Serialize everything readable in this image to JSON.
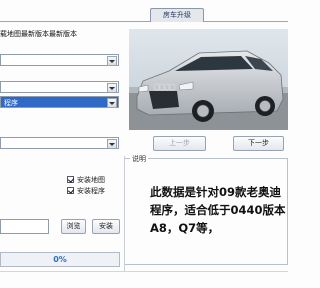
{
  "tab": {
    "label": "房车升级"
  },
  "header_text": "载地图最新版本最新版本",
  "combos": [
    {
      "value": ""
    },
    {
      "value": ""
    },
    {
      "value": "程序"
    },
    {
      "value": ""
    }
  ],
  "buttons": {
    "prev": "上一步",
    "next": "下一步",
    "browse": "浏览",
    "install": "安装"
  },
  "description": {
    "label": "说明",
    "text": "此数据是针对09款老奥迪\n程序，适合低于0440版本\nA8，Q7等，"
  },
  "options": [
    {
      "label": "安装地图",
      "checked": true
    },
    {
      "label": "安装程序",
      "checked": true
    }
  ],
  "progress": {
    "percent_text": "0%",
    "value": 0
  },
  "colors": {
    "selection": "#3169c6",
    "progress_text": "#2f6fc0",
    "car_body": "#c9ccd0"
  }
}
